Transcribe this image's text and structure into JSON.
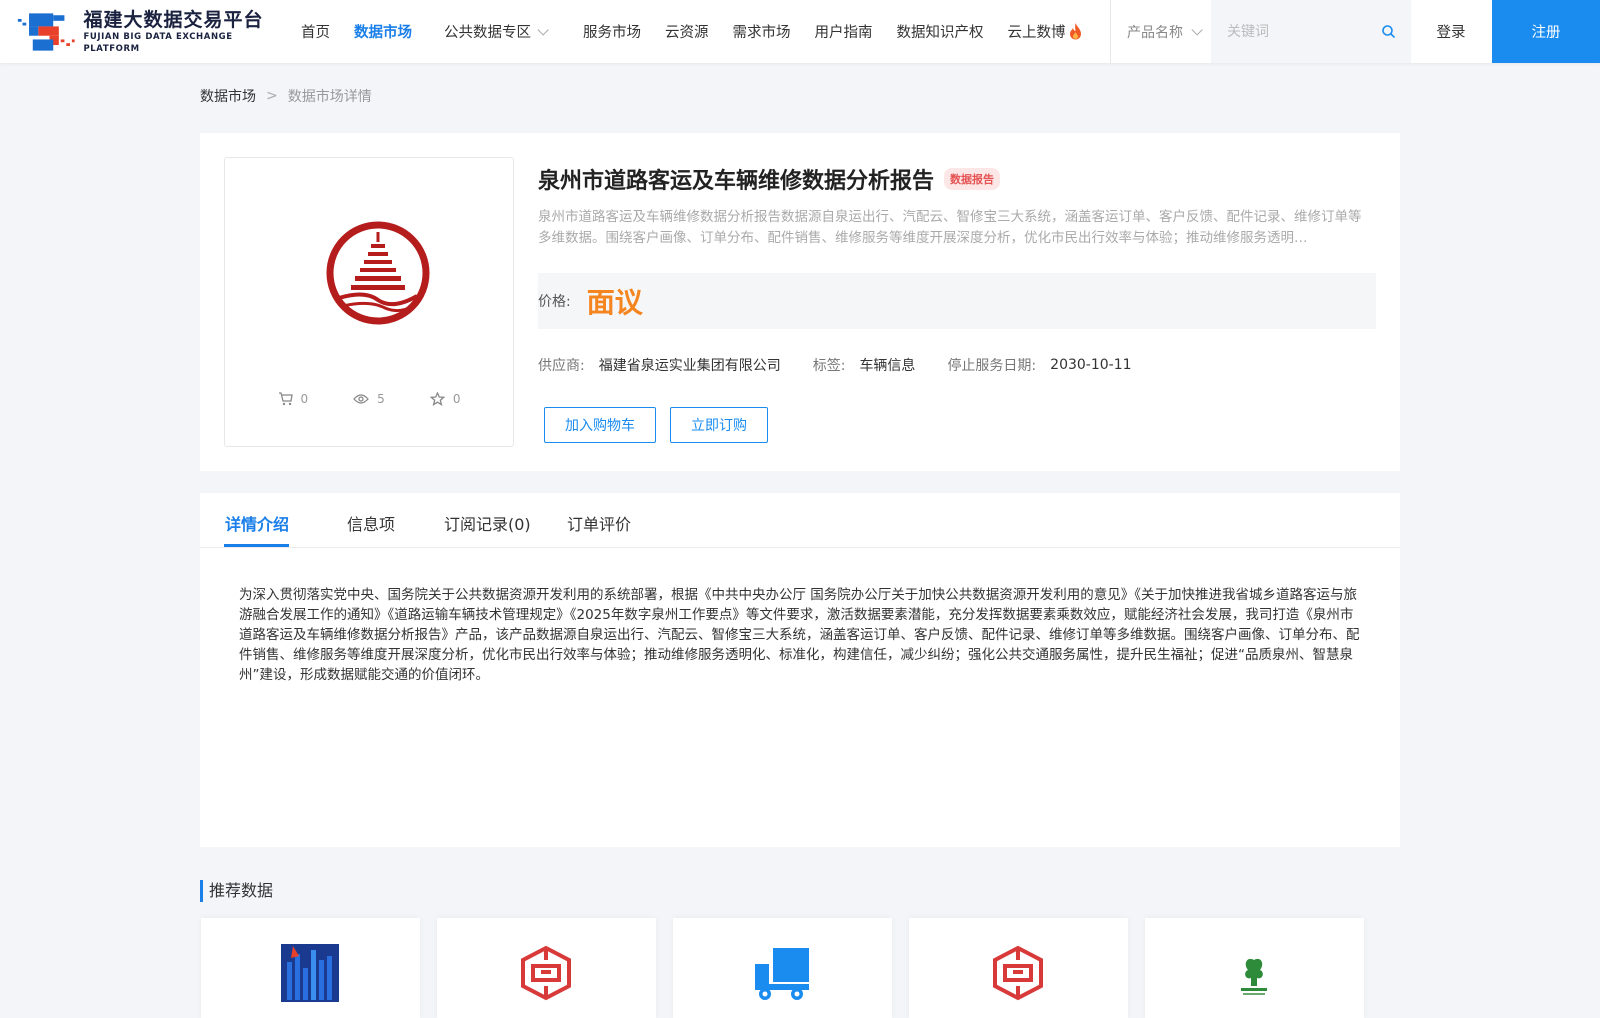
{
  "header": {
    "logo_cn": "福建大数据交易平台",
    "logo_en": "FUJIAN BIG DATA EXCHANGE  PLATFORM",
    "nav": [
      {
        "label": "首页",
        "active": false
      },
      {
        "label": "数据市场",
        "active": true
      },
      {
        "label": "公共数据专区",
        "active": false,
        "dropdown": true
      },
      {
        "label": "服务市场",
        "active": false
      },
      {
        "label": "云资源",
        "active": false
      },
      {
        "label": "需求市场",
        "active": false
      },
      {
        "label": "用户指南",
        "active": false
      },
      {
        "label": "数据知识产权",
        "active": false
      },
      {
        "label": "云上数博",
        "active": false,
        "icon": "fire-icon"
      }
    ],
    "search": {
      "select_value": "产品名称",
      "placeholder": "关键词"
    },
    "login_label": "登录",
    "register_label": "注册"
  },
  "breadcrumb": {
    "root": "数据市场",
    "separator": ">",
    "current": "数据市场详情"
  },
  "product": {
    "title": "泉州市道路客运及车辆维修数据分析报告",
    "tag": "数据报告",
    "description": "泉州市道路客运及车辆维修数据分析报告数据源自泉运出行、汽配云、智修宝三大系统，涵盖客运订单、客户反馈、配件记录、维修订单等多维数据。围绕客户画像、订单分布、配件销售、维修服务等维度开展深度分析，优化市民出行效率与体验；推动维修服务透明…",
    "price_label": "价格:",
    "price_value": "面议",
    "supplier_label": "供应商:",
    "supplier": "福建省泉运实业集团有限公司",
    "tag_label": "标签:",
    "tag_value": "车辆信息",
    "end_date_label": "停止服务日期:",
    "end_date": "2030-10-11",
    "stats": {
      "cart": "0",
      "views": "5",
      "favorites": "0"
    },
    "add_cart_label": "加入购物车",
    "subscribe_label": "立即订购"
  },
  "tabs": [
    {
      "label": "详情介绍",
      "active": true
    },
    {
      "label": "信息项",
      "active": false
    },
    {
      "label": "订阅记录(0)",
      "active": false
    },
    {
      "label": "订单评价",
      "active": false
    }
  ],
  "detail_text": "为深入贯彻落实党中央、国务院关于公共数据资源开发利用的系统部署，根据《中共中央办公厅 国务院办公厅关于加快公共数据资源开发利用的意见》《关于加快推进我省城乡道路客运与旅游融合发展工作的通知》《道路运输车辆技术管理规定》《2025年数字泉州工作要点》等文件要求，激活数据要素潜能，充分发挥数据要素乘数效应，赋能经济社会发展，我司打造《泉州市道路客运及车辆维修数据分析报告》产品，该产品数据源自泉运出行、汽配云、智修宝三大系统，涵盖客运订单、客户反馈、配件记录、维修订单等多维数据。围绕客户画像、订单分布、配件销售、维修服务等维度开展深度分析，优化市民出行效率与体验；推动维修服务透明化、标准化，构建信任，减少纠纷；强化公共交通服务属性，提升民生福祉；促进“品质泉州、智慧泉州”建设，形成数据赋能交通的价值闭环。",
  "recommended": {
    "title": "推荐数据",
    "items": [
      {
        "icon": "city-skyline-logo"
      },
      {
        "icon": "red-maze-logo"
      },
      {
        "icon": "blue-truck-logo"
      },
      {
        "icon": "red-maze-logo"
      },
      {
        "icon": "green-plant-logo"
      }
    ]
  },
  "colors": {
    "accent": "#1a8cf0",
    "price": "#f5851f",
    "tag_bg": "#fde6e6",
    "tag_text": "#e55353"
  }
}
